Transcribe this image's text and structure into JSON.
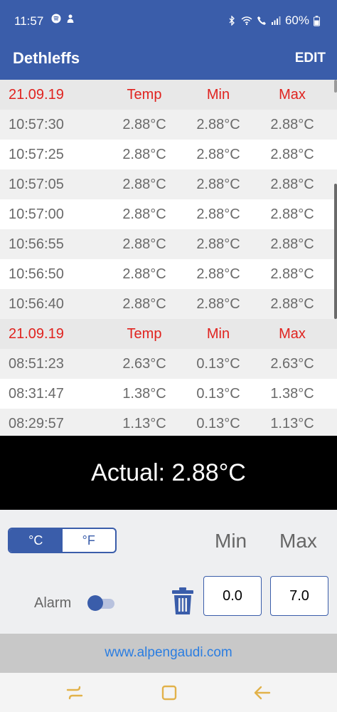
{
  "status": {
    "time": "11:57",
    "battery": "60%"
  },
  "app": {
    "title": "Dethleffs",
    "edit_label": "EDIT"
  },
  "log": {
    "rows": [
      {
        "type": "header",
        "time": "21.09.19",
        "temp": "Temp",
        "min": "Min",
        "max": "Max"
      },
      {
        "type": "data",
        "time": "10:57:30",
        "temp": "2.88°C",
        "min": "2.88°C",
        "max": "2.88°C"
      },
      {
        "type": "data",
        "time": "10:57:25",
        "temp": "2.88°C",
        "min": "2.88°C",
        "max": "2.88°C"
      },
      {
        "type": "data",
        "time": "10:57:05",
        "temp": "2.88°C",
        "min": "2.88°C",
        "max": "2.88°C"
      },
      {
        "type": "data",
        "time": "10:57:00",
        "temp": "2.88°C",
        "min": "2.88°C",
        "max": "2.88°C"
      },
      {
        "type": "data",
        "time": "10:56:55",
        "temp": "2.88°C",
        "min": "2.88°C",
        "max": "2.88°C"
      },
      {
        "type": "data",
        "time": "10:56:50",
        "temp": "2.88°C",
        "min": "2.88°C",
        "max": "2.88°C"
      },
      {
        "type": "data",
        "time": "10:56:40",
        "temp": "2.88°C",
        "min": "2.88°C",
        "max": "2.88°C"
      },
      {
        "type": "header",
        "time": "21.09.19",
        "temp": "Temp",
        "min": "Min",
        "max": "Max"
      },
      {
        "type": "data",
        "time": "08:51:23",
        "temp": "2.63°C",
        "min": "0.13°C",
        "max": "2.63°C"
      },
      {
        "type": "data",
        "time": "08:31:47",
        "temp": "1.38°C",
        "min": "0.13°C",
        "max": "1.38°C"
      },
      {
        "type": "data",
        "time": "08:29:57",
        "temp": "1.13°C",
        "min": "0.13°C",
        "max": "1.13°C"
      }
    ]
  },
  "actual": {
    "text": "Actual: 2.88°C"
  },
  "controls": {
    "unit_c": "°C",
    "unit_f": "°F",
    "selected_unit": "°C",
    "min_label": "Min",
    "max_label": "Max",
    "alarm_label": "Alarm",
    "alarm_on": true,
    "min_value": "0.0",
    "max_value": "7.0"
  },
  "footer": {
    "link_text": "www.alpengaudi.com"
  },
  "colors": {
    "primary": "#3a5daa",
    "header_text": "#e0231f",
    "link": "#2a7de1"
  },
  "icons": {
    "trash": "trash-icon",
    "recent": "recent-apps-icon",
    "home": "home-icon",
    "back": "back-icon"
  }
}
